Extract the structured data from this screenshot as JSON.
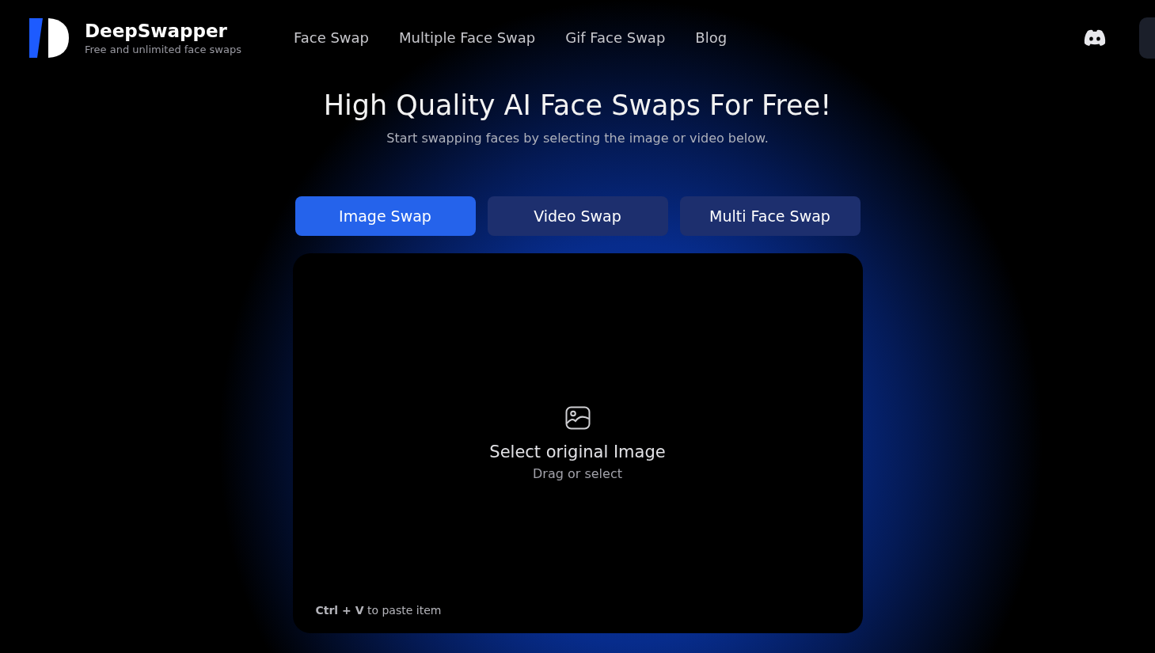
{
  "brand": {
    "name": "DeepSwapper",
    "tagline": "Free and unlimited face swaps"
  },
  "nav": [
    {
      "label": "Face Swap"
    },
    {
      "label": "Multiple Face Swap"
    },
    {
      "label": "Gif Face Swap"
    },
    {
      "label": "Blog"
    }
  ],
  "hero": {
    "title": "High Quality AI Face Swaps For Free!",
    "subtitle": "Start swapping faces by selecting the image or video below."
  },
  "tabs": [
    {
      "label": "Image Swap",
      "selected": true
    },
    {
      "label": "Video Swap",
      "selected": false
    },
    {
      "label": "Multi Face Swap",
      "selected": false
    }
  ],
  "dropzone": {
    "title": "Select original Image",
    "hint": "Drag or select",
    "paste_hint": "**Ctrl + V** to paste item"
  }
}
